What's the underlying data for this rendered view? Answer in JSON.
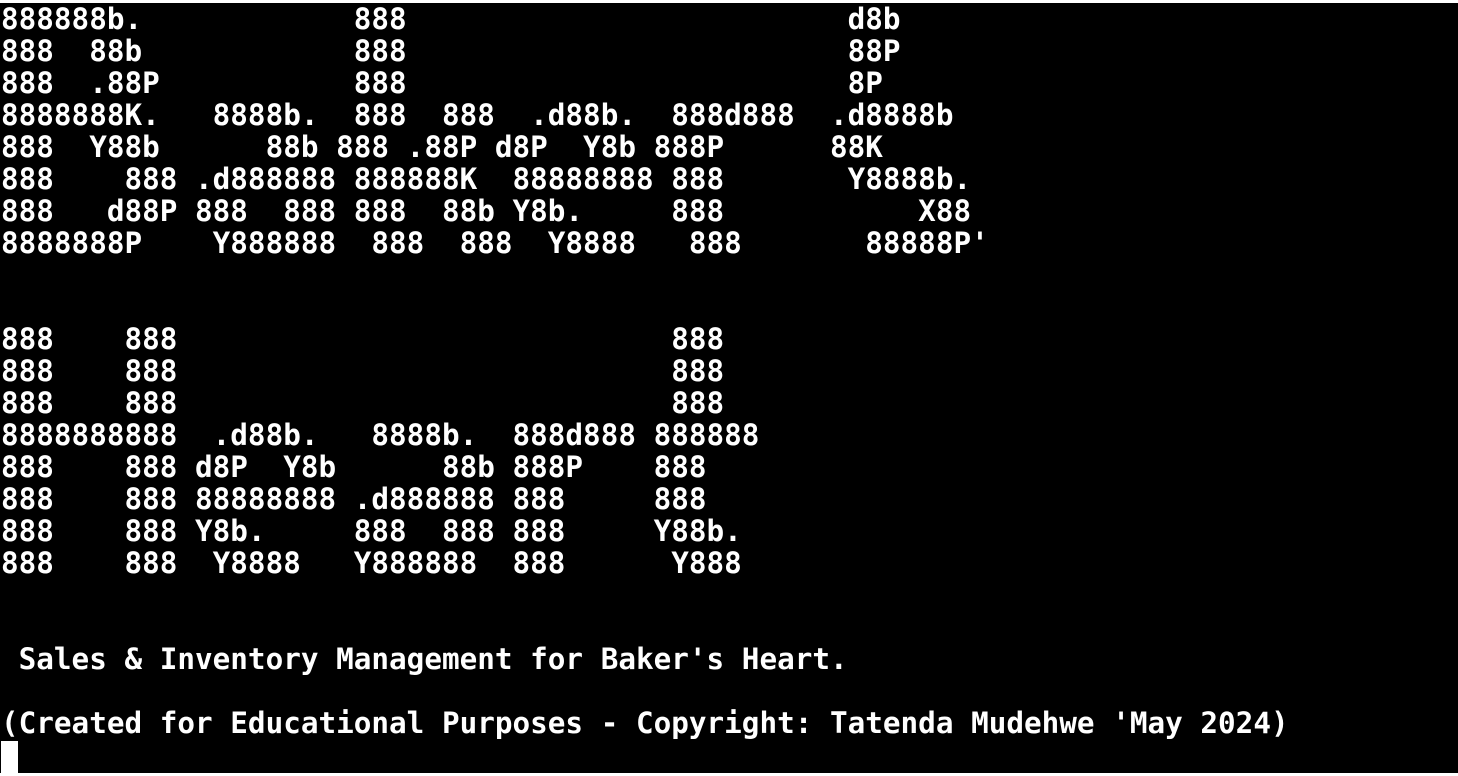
{
  "terminal": {
    "lines": [
      "888888b.            888                         d8b",
      "888  88b            888                         88P",
      "888  .88P           888                         8P",
      "8888888K.   8888b.  888  888  .d88b.  888d888  .d8888b",
      "888  Y88b      88b 888 .88P d8P  Y8b 888P      88K",
      "888    888 .d888888 888888K  88888888 888       Y8888b.",
      "888   d88P 888  888 888  88b Y8b.     888           X88",
      "8888888P    Y888888  888  888  Y8888   888       88888P'",
      "",
      "",
      "888    888                            888",
      "888    888                            888",
      "888    888                            888",
      "8888888888  .d88b.   8888b.  888d888 888888",
      "888    888 d8P  Y8b      88b 888P    888",
      "888    888 88888888 .d888888 888     888",
      "888    888 Y8b.     888  888 888     Y88b.",
      "888    888  Y8888   Y888888  888      Y888",
      "",
      "",
      " Sales & Inventory Management for Baker's Heart.",
      "",
      "(Created for Educational Purposes - Copyright: Tatenda Mudehwe 'May 2024)"
    ]
  },
  "colors": {
    "background": "#000000",
    "foreground": "#ffffff",
    "page": "#ffffff"
  }
}
